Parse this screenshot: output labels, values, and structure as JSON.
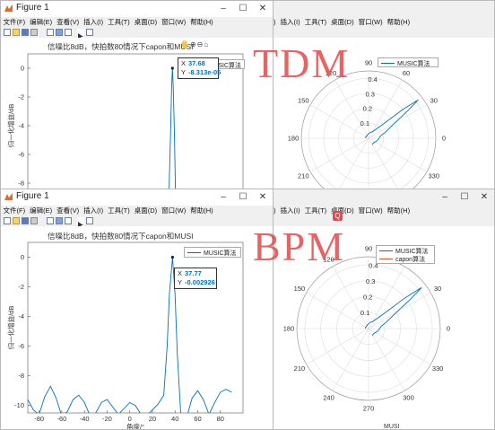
{
  "window_title": "Figure 1",
  "window_buttons": {
    "minimize": "–",
    "maximize": "☐",
    "close": "✕"
  },
  "menu": [
    "文件(F)",
    "编辑(E)",
    "查看(V)",
    "插入(I)",
    "工具(T)",
    "桌面(D)",
    "窗口(W)",
    "帮助(H)"
  ],
  "axes_toolbar": [
    "🖐",
    "⊕",
    "⊖",
    "⌂"
  ],
  "annotations": {
    "top": "TDM",
    "bottom": "BPM"
  },
  "colors": {
    "series_music": "#0072bd",
    "series_capon": "#d95319",
    "annotation": "#e34a4a"
  },
  "figure_top": {
    "title": "信噪比8dB，快拍数80情况下capon和MUSI",
    "legend": [
      "MUSIC算法"
    ],
    "datatip": {
      "x_key": "X",
      "x_val": "37.68",
      "y_key": "Y",
      "y_val": "-8.313e-05"
    },
    "polar_legend": [
      "MUSIC算法"
    ]
  },
  "figure_bottom": {
    "title": "信噪比8dB，快拍数80情况下capon和MUSI",
    "legend": [
      "MUSIC算法"
    ],
    "datatip": {
      "x_key": "X",
      "x_val": "37.77",
      "y_key": "Y",
      "y_val": "-0.002926"
    },
    "polar_legend": [
      "MUSIC算法",
      "capon算法"
    ],
    "polar_caption": "MUSI"
  },
  "chart_data": [
    {
      "type": "line",
      "title": "信噪比8dB，快拍数80情况下capon和MUSI",
      "xlabel": "",
      "ylabel": "归一化增益/dB",
      "ylim": [
        -9,
        1
      ],
      "yticks": [
        0,
        -2,
        -4,
        -6,
        -8
      ],
      "series": [
        {
          "name": "MUSIC算法",
          "x": [
            34.5,
            36.0,
            37.0,
            37.68,
            38.4,
            39.4,
            40.5
          ],
          "y": [
            -9.0,
            -4.5,
            -1.3,
            0.0,
            -1.3,
            -4.5,
            -9.0
          ]
        }
      ]
    },
    {
      "type": "line",
      "title": "信噪比8dB，快拍数80情况下capon和MUSI",
      "xlabel": "角度/°",
      "ylabel": "归一化增益/dB",
      "xlim": [
        -90,
        100
      ],
      "ylim": [
        -10.5,
        1
      ],
      "xticks": [
        -80,
        -60,
        -40,
        -20,
        0,
        20,
        40,
        60,
        80
      ],
      "yticks": [
        0,
        -2,
        -4,
        -6,
        -8,
        -10
      ],
      "series": [
        {
          "name": "MUSIC算法",
          "x": [
            -90,
            -85,
            -80,
            -75,
            -70,
            -65,
            -60,
            -55,
            -50,
            -45,
            -40,
            -35,
            -30,
            -25,
            -20,
            -15,
            -10,
            -5,
            0,
            5,
            10,
            15,
            20,
            25,
            30,
            33,
            35,
            37.77,
            40,
            42,
            45,
            50,
            55,
            60,
            65,
            70,
            75,
            80,
            85,
            90
          ],
          "y": [
            -9.6,
            -10.3,
            -10.6,
            -9.4,
            -8.7,
            -9.5,
            -10.7,
            -10.4,
            -9.6,
            -9.3,
            -9.8,
            -10.7,
            -10.5,
            -9.8,
            -9.6,
            -10.1,
            -10.6,
            -10.2,
            -9.8,
            -10.0,
            -10.6,
            -10.7,
            -10.3,
            -9.9,
            -9.3,
            -6.0,
            -2.5,
            0.0,
            -2.5,
            -6.5,
            -10.5,
            -10.9,
            -9.5,
            -9.0,
            -9.6,
            -10.6,
            -9.8,
            -9.1,
            -8.9,
            -9.1
          ]
        }
      ]
    },
    {
      "type": "line",
      "subtype": "polar",
      "title": "",
      "r_ticks": [
        0.1,
        0.2,
        0.3,
        0.4
      ],
      "theta_ticks": [
        0,
        30,
        60,
        90,
        120,
        150,
        180,
        210,
        240,
        270,
        300,
        330
      ],
      "series": [
        {
          "name": "MUSIC算法",
          "theta": [
            -60,
            -45,
            -30,
            -15,
            0,
            10,
            20,
            30,
            35,
            37.7,
            40,
            45,
            60,
            75,
            90,
            105,
            120,
            135,
            150,
            165,
            180
          ],
          "r": [
            0.05,
            0.045,
            0.05,
            0.06,
            0.07,
            0.08,
            0.12,
            0.2,
            0.32,
            0.42,
            0.3,
            0.12,
            0.05,
            0.04,
            0.03,
            0.025,
            0.02,
            0.02,
            0.02,
            0.02,
            0.02
          ]
        }
      ]
    },
    {
      "type": "line",
      "subtype": "polar",
      "title": "",
      "r_ticks": [
        0.1,
        0.2,
        0.3,
        0.4
      ],
      "theta_ticks": [
        0,
        30,
        60,
        90,
        120,
        150,
        180,
        210,
        240,
        270,
        300,
        330
      ],
      "series": [
        {
          "name": "MUSIC算法",
          "theta": [
            -60,
            -45,
            -30,
            -15,
            0,
            10,
            20,
            30,
            35,
            37.7,
            40,
            45,
            60,
            75,
            90,
            105,
            120,
            135,
            150,
            165,
            180
          ],
          "r": [
            0.05,
            0.045,
            0.05,
            0.06,
            0.07,
            0.08,
            0.12,
            0.2,
            0.32,
            0.42,
            0.3,
            0.12,
            0.05,
            0.04,
            0.03,
            0.025,
            0.02,
            0.02,
            0.02,
            0.02,
            0.02
          ]
        },
        {
          "name": "capon算法",
          "theta": [],
          "r": []
        }
      ]
    }
  ]
}
